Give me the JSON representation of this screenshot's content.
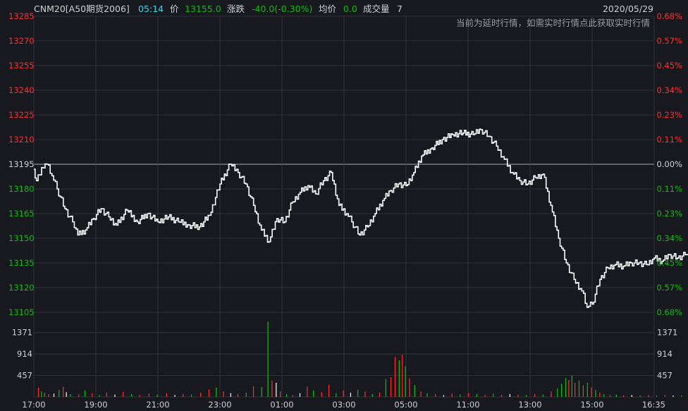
{
  "header": {
    "symbol": "CNM20[A50期货2006]",
    "time": "05:14",
    "price_label": "价",
    "price": "13155.0",
    "change_label": "涨跌",
    "change": "-40.0(-0.30%)",
    "avg_label": "均价",
    "avg": "0.0",
    "volume_label": "成交量",
    "volume": "7",
    "date": "2020/05/29",
    "notice": "当前为延时行情，如需实时行情点此获取实时行情"
  },
  "colors": {
    "background": "#17191f",
    "grid": "#2e3139",
    "baseline": "#8c8f96",
    "up": "#ff2d2d",
    "down": "#13b913",
    "flat": "#ffffff",
    "price_line": "#ffffff",
    "time_text": "#3ad8e8",
    "label_text": "#d0d0d0"
  },
  "chart_data": {
    "type": "line",
    "prev_close": 13195,
    "price_axis": {
      "ticks": [
        13285,
        13270,
        13255,
        13240,
        13225,
        13210,
        13195,
        13180,
        13165,
        13150,
        13135,
        13120,
        13105
      ],
      "ylim": [
        13105,
        13285
      ],
      "pct_ticks": [
        "0.68%",
        "0.57%",
        "0.45%",
        "0.34%",
        "0.23%",
        "0.11%",
        "0.00%",
        "0.11%",
        "0.23%",
        "0.34%",
        "0.45%",
        "0.57%",
        "0.68%"
      ]
    },
    "volume_axis": {
      "ticks": [
        1371,
        914,
        457
      ],
      "ylim": [
        0,
        1800
      ]
    },
    "x_ticks": [
      "17:00",
      "19:00",
      "21:00",
      "23:00",
      "01:00",
      "03:00",
      "05:00",
      "11:00",
      "13:00",
      "15:00",
      "16:35"
    ],
    "session_end_index": 1335,
    "current_index": 1354,
    "price_points": [
      [
        0,
        13192
      ],
      [
        5,
        13185
      ],
      [
        15,
        13193
      ],
      [
        25,
        13195
      ],
      [
        35,
        13188
      ],
      [
        45,
        13180
      ],
      [
        60,
        13168
      ],
      [
        75,
        13160
      ],
      [
        85,
        13152
      ],
      [
        100,
        13155
      ],
      [
        115,
        13162
      ],
      [
        130,
        13168
      ],
      [
        145,
        13163
      ],
      [
        160,
        13158
      ],
      [
        180,
        13167
      ],
      [
        200,
        13160
      ],
      [
        220,
        13165
      ],
      [
        240,
        13160
      ],
      [
        260,
        13163
      ],
      [
        280,
        13160
      ],
      [
        300,
        13158
      ],
      [
        320,
        13157
      ],
      [
        340,
        13164
      ],
      [
        360,
        13183
      ],
      [
        380,
        13195
      ],
      [
        395,
        13190
      ],
      [
        410,
        13183
      ],
      [
        425,
        13170
      ],
      [
        440,
        13155
      ],
      [
        455,
        13148
      ],
      [
        470,
        13162
      ],
      [
        485,
        13160
      ],
      [
        500,
        13172
      ],
      [
        515,
        13178
      ],
      [
        530,
        13182
      ],
      [
        545,
        13177
      ],
      [
        560,
        13185
      ],
      [
        575,
        13190
      ],
      [
        590,
        13170
      ],
      [
        605,
        13165
      ],
      [
        615,
        13160
      ],
      [
        630,
        13152
      ],
      [
        645,
        13157
      ],
      [
        660,
        13165
      ],
      [
        675,
        13173
      ],
      [
        690,
        13179
      ],
      [
        705,
        13183
      ],
      [
        720,
        13182
      ],
      [
        735,
        13190
      ],
      [
        750,
        13200
      ],
      [
        770,
        13205
      ],
      [
        790,
        13210
      ],
      [
        810,
        13213
      ],
      [
        830,
        13214
      ],
      [
        850,
        13213
      ],
      [
        865,
        13216
      ],
      [
        880,
        13212
      ],
      [
        895,
        13206
      ],
      [
        910,
        13198
      ],
      [
        925,
        13190
      ],
      [
        940,
        13185
      ],
      [
        955,
        13183
      ],
      [
        970,
        13187
      ],
      [
        985,
        13189
      ],
      [
        1000,
        13170
      ],
      [
        1015,
        13150
      ],
      [
        1030,
        13135
      ],
      [
        1045,
        13125
      ],
      [
        1060,
        13118
      ],
      [
        1070,
        13108
      ],
      [
        1080,
        13110
      ],
      [
        1095,
        13125
      ],
      [
        1110,
        13132
      ],
      [
        1125,
        13134
      ],
      [
        1140,
        13133
      ],
      [
        1155,
        13135
      ],
      [
        1170,
        13135
      ],
      [
        1185,
        13134
      ],
      [
        1200,
        13138
      ],
      [
        1215,
        13136
      ],
      [
        1230,
        13140
      ],
      [
        1245,
        13138
      ],
      [
        1260,
        13140
      ],
      [
        1270,
        13143
      ],
      [
        1280,
        13155
      ]
    ],
    "volume_bars": [
      [
        8,
        200,
        "up"
      ],
      [
        14,
        120,
        "down"
      ],
      [
        20,
        90,
        "down"
      ],
      [
        28,
        60,
        "up"
      ],
      [
        38,
        70,
        "flat"
      ],
      [
        48,
        150,
        "down"
      ],
      [
        56,
        220,
        "up"
      ],
      [
        62,
        100,
        "flat"
      ],
      [
        70,
        60,
        "down"
      ],
      [
        86,
        50,
        "up"
      ],
      [
        98,
        140,
        "down"
      ],
      [
        112,
        80,
        "up"
      ],
      [
        126,
        40,
        "down"
      ],
      [
        140,
        90,
        "up"
      ],
      [
        156,
        50,
        "flat"
      ],
      [
        172,
        110,
        "up"
      ],
      [
        188,
        60,
        "down"
      ],
      [
        204,
        40,
        "up"
      ],
      [
        222,
        70,
        "up"
      ],
      [
        238,
        50,
        "down"
      ],
      [
        256,
        80,
        "up"
      ],
      [
        272,
        40,
        "flat"
      ],
      [
        288,
        60,
        "up"
      ],
      [
        304,
        50,
        "down"
      ],
      [
        322,
        90,
        "up"
      ],
      [
        338,
        160,
        "up"
      ],
      [
        352,
        200,
        "down"
      ],
      [
        366,
        120,
        "up"
      ],
      [
        380,
        80,
        "flat"
      ],
      [
        394,
        60,
        "up"
      ],
      [
        410,
        90,
        "down"
      ],
      [
        424,
        230,
        "up"
      ],
      [
        440,
        210,
        "down"
      ],
      [
        452,
        1600,
        "down"
      ],
      [
        460,
        350,
        "up"
      ],
      [
        468,
        300,
        "flat"
      ],
      [
        476,
        120,
        "up"
      ],
      [
        488,
        60,
        "down"
      ],
      [
        500,
        40,
        "up"
      ],
      [
        514,
        80,
        "flat"
      ],
      [
        528,
        220,
        "up"
      ],
      [
        540,
        140,
        "down"
      ],
      [
        556,
        100,
        "up"
      ],
      [
        570,
        260,
        "up"
      ],
      [
        584,
        80,
        "down"
      ],
      [
        598,
        140,
        "up"
      ],
      [
        612,
        90,
        "flat"
      ],
      [
        626,
        150,
        "down"
      ],
      [
        640,
        110,
        "up"
      ],
      [
        654,
        60,
        "down"
      ],
      [
        668,
        90,
        "up"
      ],
      [
        680,
        380,
        "down"
      ],
      [
        690,
        420,
        "up"
      ],
      [
        698,
        850,
        "up"
      ],
      [
        706,
        780,
        "down"
      ],
      [
        712,
        900,
        "up"
      ],
      [
        718,
        650,
        "down"
      ],
      [
        726,
        400,
        "up"
      ],
      [
        736,
        250,
        "down"
      ],
      [
        748,
        120,
        "up"
      ],
      [
        760,
        80,
        "down"
      ],
      [
        776,
        60,
        "up"
      ],
      [
        792,
        40,
        "flat"
      ],
      [
        808,
        70,
        "up"
      ],
      [
        824,
        50,
        "down"
      ],
      [
        840,
        80,
        "up"
      ],
      [
        856,
        60,
        "down"
      ],
      [
        872,
        40,
        "up"
      ],
      [
        888,
        70,
        "down"
      ],
      [
        904,
        50,
        "up"
      ],
      [
        920,
        60,
        "flat"
      ],
      [
        936,
        50,
        "up"
      ],
      [
        952,
        40,
        "down"
      ],
      [
        968,
        60,
        "up"
      ],
      [
        984,
        50,
        "down"
      ],
      [
        1000,
        120,
        "up"
      ],
      [
        1012,
        180,
        "down"
      ],
      [
        1020,
        280,
        "down"
      ],
      [
        1028,
        400,
        "down"
      ],
      [
        1034,
        360,
        "up"
      ],
      [
        1040,
        460,
        "down"
      ],
      [
        1046,
        300,
        "up"
      ],
      [
        1054,
        350,
        "down"
      ],
      [
        1062,
        250,
        "up"
      ],
      [
        1070,
        300,
        "down"
      ],
      [
        1078,
        200,
        "up"
      ],
      [
        1086,
        150,
        "down"
      ],
      [
        1094,
        90,
        "up"
      ],
      [
        1102,
        60,
        "down"
      ],
      [
        1114,
        40,
        "up"
      ],
      [
        1126,
        50,
        "down"
      ],
      [
        1140,
        30,
        "up"
      ],
      [
        1156,
        40,
        "flat"
      ],
      [
        1172,
        30,
        "down"
      ],
      [
        1188,
        40,
        "up"
      ],
      [
        1204,
        30,
        "down"
      ],
      [
        1220,
        40,
        "up"
      ],
      [
        1236,
        30,
        "flat"
      ],
      [
        1252,
        30,
        "down"
      ],
      [
        1268,
        40,
        "up"
      ],
      [
        1280,
        30,
        "down"
      ]
    ]
  }
}
